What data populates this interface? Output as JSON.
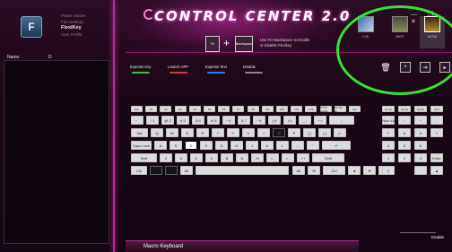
{
  "app": {
    "title": "CONTROL CENTER 2.0",
    "accent_color": "#c0269a",
    "logo_icon": "keyboard-app-icon",
    "logo_letter": "F"
  },
  "sidebar": {
    "menu": [
      {
        "label": "Power Modes",
        "active": false
      },
      {
        "label": "Fan Settings",
        "active": false
      },
      {
        "label": "FlexiKey",
        "active": true
      },
      {
        "label": "User Profile",
        "active": false
      }
    ],
    "name_label": "Name:",
    "name_value": "D"
  },
  "fn_combo": {
    "key1": "Fn",
    "key2": "Backspace",
    "description_line1": "Use Fn+Backspace to Enable",
    "description_line2": "or Disable Flexikey"
  },
  "profiles": [
    {
      "label": "LOL",
      "selected": false
    },
    {
      "label": "WOT",
      "selected": false
    },
    {
      "label": "WOW",
      "selected": true
    }
  ],
  "modes": [
    {
      "label": "Express Key",
      "color": "#36c23a"
    },
    {
      "label": "Launch APP",
      "color": "#d83a3a"
    },
    {
      "label": "Express Text",
      "color": "#2f7ee8"
    },
    {
      "label": "Disable",
      "color": "#888888"
    }
  ],
  "keyboard": {
    "fn_row": [
      "Esc",
      "F1",
      "F2",
      "F3",
      "F4",
      "F5",
      "F6",
      "F7",
      "F8",
      "F9",
      "F10",
      "F11",
      "F12",
      "Prt Sc SysRq",
      "Ins Scr Lk",
      "Del"
    ],
    "num_row": [
      "~ `",
      "! 1",
      "@ 2",
      "# 3",
      "$ 4",
      "% 5",
      "^ 6",
      "& 7",
      "* 8",
      "( 9",
      ") 0",
      "_ -",
      "+ =",
      "←"
    ],
    "q_row": [
      "Tab",
      "Q",
      "W",
      "E",
      "R",
      "T",
      "Y",
      "U",
      "I",
      "O",
      "P",
      "{ [",
      "} ]",
      "| \\"
    ],
    "a_row": [
      "Caps Lock",
      "A",
      "S",
      "D",
      "F",
      "G",
      "H",
      "J",
      "K",
      "L",
      ": ;",
      "\" '",
      "↵"
    ],
    "z_row": [
      "Shift",
      "Z",
      "X",
      "C",
      "V",
      "B",
      "N",
      "M",
      "< ,",
      "> .",
      "? /",
      "Shift"
    ],
    "bottom_row": [
      "Ctrl",
      "",
      "",
      "Alt",
      "",
      "Alt",
      "☰",
      "Ctrl",
      "◄",
      "▼",
      "►"
    ],
    "numpad_top": [
      "Home",
      "Pg Up",
      "Pg Dn",
      "End"
    ],
    "numpad": [
      "Num Lk",
      "/",
      "*",
      "-",
      "7",
      "8",
      "9",
      "+",
      "4",
      "5",
      "6",
      "1",
      "2",
      "3",
      "Enter",
      "0",
      ".",
      "▲"
    ]
  },
  "bottom": {
    "label": "Macro Keyboard",
    "enable_label": "Enable"
  }
}
